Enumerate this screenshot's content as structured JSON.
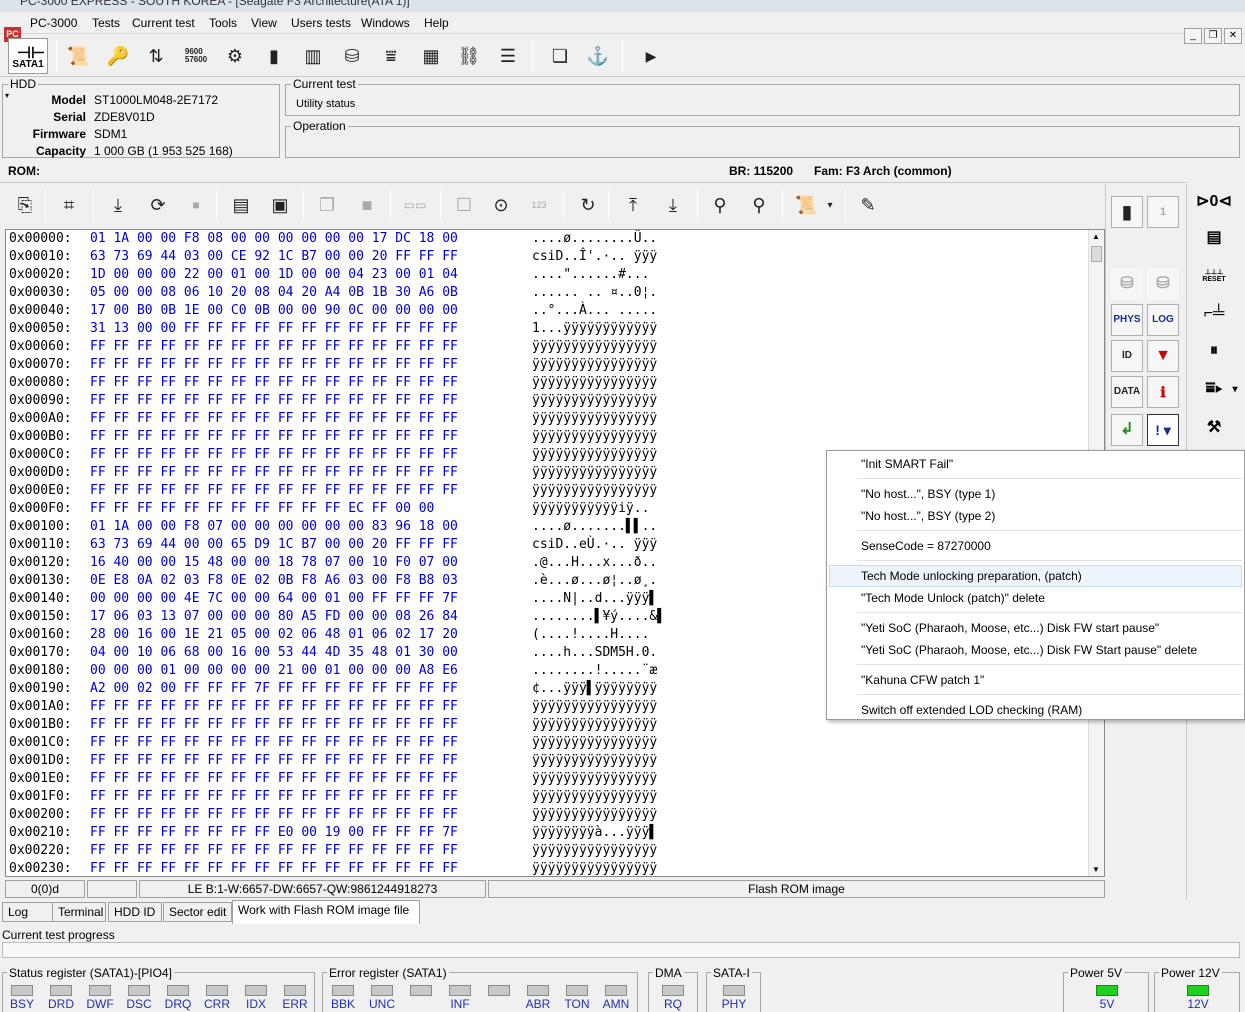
{
  "window": {
    "title": "PC-3000 EXPRESS - SOUTH KOREA - [Seagate F3 Architecture(ATA 1)]",
    "app_icon": "PC"
  },
  "menu": [
    "PC-3000",
    "Tests",
    "Current test",
    "Tools",
    "View",
    "Users tests",
    "Windows",
    "Help"
  ],
  "toolbar": {
    "sata_label": "SATA1",
    "baud_icon_text": "9600\n57600"
  },
  "hdd": {
    "group_title": "HDD",
    "model_label": "Model",
    "model": "ST1000LM048-2E7172",
    "serial_label": "Serial",
    "serial": "ZDE8V01D",
    "firmware_label": "Firmware",
    "firmware": "SDM1",
    "capacity_label": "Capacity",
    "capacity": "1 000 GB (1 953 525 168)"
  },
  "current_test": {
    "group_title": "Current test",
    "value": "Utility status"
  },
  "operation": {
    "group_title": "Operation"
  },
  "info": {
    "rom": "ROM:",
    "br": "BR: 115200",
    "fam": "Fam: F3 Arch (common)"
  },
  "hex_rows": [
    {
      "a": "0x00000:",
      "h": "01 1A 00 00 F8 08 00 00 00 00 00 00 17 DC 18 00",
      "c": "....ø........Ü.."
    },
    {
      "a": "0x00010:",
      "h": "63 73 69 44 03 00 CE 92 1C B7 00 00 20 FF FF FF",
      "c": "csiD..Î'.·.. ÿÿÿ"
    },
    {
      "a": "0x00020:",
      "h": "1D 00 00 00 22 00 01 00 1D 00 00 04 23 00 01 04",
      "c": "....\"......#..."
    },
    {
      "a": "0x00030:",
      "h": "05 00 00 08 06 10 20 08 04 20 A4 0B 1B 30 A6 0B",
      "c": "...... .. ¤..0¦."
    },
    {
      "a": "0x00040:",
      "h": "17 00 B0 0B 1E 00 C0 0B 00 00 90 0C 00 00 00 00",
      "c": "..°...À... ....."
    },
    {
      "a": "0x00050:",
      "h": "31 13 00 00 FF FF FF FF FF FF FF FF FF FF FF FF",
      "c": "1...ÿÿÿÿÿÿÿÿÿÿÿÿ"
    },
    {
      "a": "0x00060:",
      "h": "FF FF FF FF FF FF FF FF FF FF FF FF FF FF FF FF",
      "c": "ÿÿÿÿÿÿÿÿÿÿÿÿÿÿÿÿ"
    },
    {
      "a": "0x00070:",
      "h": "FF FF FF FF FF FF FF FF FF FF FF FF FF FF FF FF",
      "c": "ÿÿÿÿÿÿÿÿÿÿÿÿÿÿÿÿ"
    },
    {
      "a": "0x00080:",
      "h": "FF FF FF FF FF FF FF FF FF FF FF FF FF FF FF FF",
      "c": "ÿÿÿÿÿÿÿÿÿÿÿÿÿÿÿÿ"
    },
    {
      "a": "0x00090:",
      "h": "FF FF FF FF FF FF FF FF FF FF FF FF FF FF FF FF",
      "c": "ÿÿÿÿÿÿÿÿÿÿÿÿÿÿÿÿ"
    },
    {
      "a": "0x000A0:",
      "h": "FF FF FF FF FF FF FF FF FF FF FF FF FF FF FF FF",
      "c": "ÿÿÿÿÿÿÿÿÿÿÿÿÿÿÿÿ"
    },
    {
      "a": "0x000B0:",
      "h": "FF FF FF FF FF FF FF FF FF FF FF FF FF FF FF FF",
      "c": "ÿÿÿÿÿÿÿÿÿÿÿÿÿÿÿÿ"
    },
    {
      "a": "0x000C0:",
      "h": "FF FF FF FF FF FF FF FF FF FF FF FF FF FF FF FF",
      "c": "ÿÿÿÿÿÿÿÿÿÿÿÿÿÿÿÿ"
    },
    {
      "a": "0x000D0:",
      "h": "FF FF FF FF FF FF FF FF FF FF FF FF FF FF FF FF",
      "c": "ÿÿÿÿÿÿÿÿÿÿÿÿÿÿÿÿ"
    },
    {
      "a": "0x000E0:",
      "h": "FF FF FF FF FF FF FF FF FF FF FF FF FF FF FF FF",
      "c": "ÿÿÿÿÿÿÿÿÿÿÿÿÿÿÿÿ"
    },
    {
      "a": "0x000F0:",
      "h": "FF FF FF FF FF FF FF FF FF FF FF EC FF 00 00",
      "c": "ÿÿÿÿÿÿÿÿÿÿÿiÿ.."
    },
    {
      "a": "0x00100:",
      "h": "01 1A 00 00 F8 07 00 00 00 00 00 00 83 96 18 00",
      "c": "....ø.......▌▌.."
    },
    {
      "a": "0x00110:",
      "h": "63 73 69 44 00 00 65 D9 1C B7 00 00 20 FF FF FF",
      "c": "csiD..eÙ.·.. ÿÿÿ"
    },
    {
      "a": "0x00120:",
      "h": "16 40 00 00 15 48 00 00 18 78 07 00 10 F0 07 00",
      "c": ".@...H...x...ð.."
    },
    {
      "a": "0x00130:",
      "h": "0E E8 0A 02 03 F8 0E 02 0B F8 A6 03 00 F8 B8 03",
      "c": ".è...ø...ø¦..ø¸."
    },
    {
      "a": "0x00140:",
      "h": "00 00 00 00 4E 7C 00 00 64 00 01 00 FF FF FF 7F",
      "c": "....N|..d...ÿÿÿ▌"
    },
    {
      "a": "0x00150:",
      "h": "17 06 03 13 07 00 00 00 80 A5 FD 00 00 08 26 84",
      "c": "........▌¥ý....&▌"
    },
    {
      "a": "0x00160:",
      "h": "28 00 16 00 1E 21 05 00 02 06 48 01 06 02 17 20",
      "c": "(....!....H.... "
    },
    {
      "a": "0x00170:",
      "h": "04 00 10 06 68 00 16 00 53 44 4D 35 48 01 30 00",
      "c": "....h...SDM5H.0."
    },
    {
      "a": "0x00180:",
      "h": "00 00 00 01 00 00 00 00 21 00 01 00 00 00 A8 E6",
      "c": "........!.....¨æ"
    },
    {
      "a": "0x00190:",
      "h": "A2 00 02 00 FF FF FF 7F FF FF FF FF FF FF FF FF",
      "c": "¢...ÿÿÿ▌ÿÿÿÿÿÿÿÿ"
    },
    {
      "a": "0x001A0:",
      "h": "FF FF FF FF FF FF FF FF FF FF FF FF FF FF FF FF",
      "c": "ÿÿÿÿÿÿÿÿÿÿÿÿÿÿÿÿ"
    },
    {
      "a": "0x001B0:",
      "h": "FF FF FF FF FF FF FF FF FF FF FF FF FF FF FF FF",
      "c": "ÿÿÿÿÿÿÿÿÿÿÿÿÿÿÿÿ"
    },
    {
      "a": "0x001C0:",
      "h": "FF FF FF FF FF FF FF FF FF FF FF FF FF FF FF FF",
      "c": "ÿÿÿÿÿÿÿÿÿÿÿÿÿÿÿÿ"
    },
    {
      "a": "0x001D0:",
      "h": "FF FF FF FF FF FF FF FF FF FF FF FF FF FF FF FF",
      "c": "ÿÿÿÿÿÿÿÿÿÿÿÿÿÿÿÿ"
    },
    {
      "a": "0x001E0:",
      "h": "FF FF FF FF FF FF FF FF FF FF FF FF FF FF FF FF",
      "c": "ÿÿÿÿÿÿÿÿÿÿÿÿÿÿÿÿ"
    },
    {
      "a": "0x001F0:",
      "h": "FF FF FF FF FF FF FF FF FF FF FF FF FF FF FF FF",
      "c": "ÿÿÿÿÿÿÿÿÿÿÿÿÿÿÿÿ"
    },
    {
      "a": "0x00200:",
      "h": "FF FF FF FF FF FF FF FF FF FF FF FF FF FF FF FF",
      "c": "ÿÿÿÿÿÿÿÿÿÿÿÿÿÿÿÿ"
    },
    {
      "a": "0x00210:",
      "h": "FF FF FF FF FF FF FF FF E0 00 19 00 FF FF FF 7F",
      "c": "ÿÿÿÿÿÿÿÿà...ÿÿÿ▌"
    },
    {
      "a": "0x00220:",
      "h": "FF FF FF FF FF FF FF FF FF FF FF FF FF FF FF FF",
      "c": "ÿÿÿÿÿÿÿÿÿÿÿÿÿÿÿÿ"
    },
    {
      "a": "0x00230:",
      "h": "FF FF FF FF FF FF FF FF FF FF FF FF FF FF FF FF",
      "c": "ÿÿÿÿÿÿÿÿÿÿÿÿÿÿÿÿ"
    }
  ],
  "status": {
    "pos": "0(0)d",
    "le": "LE B:1-W:6657-DW:6657-QW:9861244918273",
    "mode": "Flash ROM image"
  },
  "tabs": [
    "Log",
    "Terminal",
    "HDD ID",
    "Sector edit",
    "Work with Flash ROM image file"
  ],
  "progress_label": "Current test progress",
  "right_panel": {
    "page_number": "1",
    "phys_label": "PHYS",
    "log_label": "LOG",
    "id_label": "ID",
    "data_label": "DATA",
    "reset_label": "RESET"
  },
  "popup_items": [
    "\"Init SMART Fail\"",
    "\"No host...\", BSY (type 1)",
    "\"No host...\", BSY (type 2)",
    "SenseCode = 87270000",
    "Tech Mode unlocking preparation, (patch)",
    "\"Tech Mode Unlock (patch)\" delete",
    "\"Yeti SoC (Pharaoh, Moose, etc...) Disk FW start pause\"",
    "\"Yeti SoC (Pharaoh, Moose, etc...) Disk FW Start pause\" delete",
    "\"Kahuna CFW patch 1\"",
    "Switch off extended LOD checking (RAM)"
  ],
  "status_register": {
    "title": "Status register (SATA1)-[PIO4]",
    "leds": [
      "BSY",
      "DRD",
      "DWF",
      "DSC",
      "DRQ",
      "CRR",
      "IDX",
      "ERR"
    ]
  },
  "error_register": {
    "title": "Error register (SATA1)",
    "leds": [
      "BBK",
      "UNC",
      "",
      "INF",
      "",
      "ABR",
      "TON",
      "AMN"
    ]
  },
  "dma": {
    "title": "DMA",
    "led": "RQ"
  },
  "sata_i": {
    "title": "SATA-I",
    "led": "PHY"
  },
  "power5": {
    "title": "Power 5V",
    "led": "5V"
  },
  "power12": {
    "title": "Power 12V",
    "led": "12V"
  },
  "colors": {
    "hex": "#0000c8",
    "led_on": "#20d020",
    "led_label": "#2030b0"
  }
}
